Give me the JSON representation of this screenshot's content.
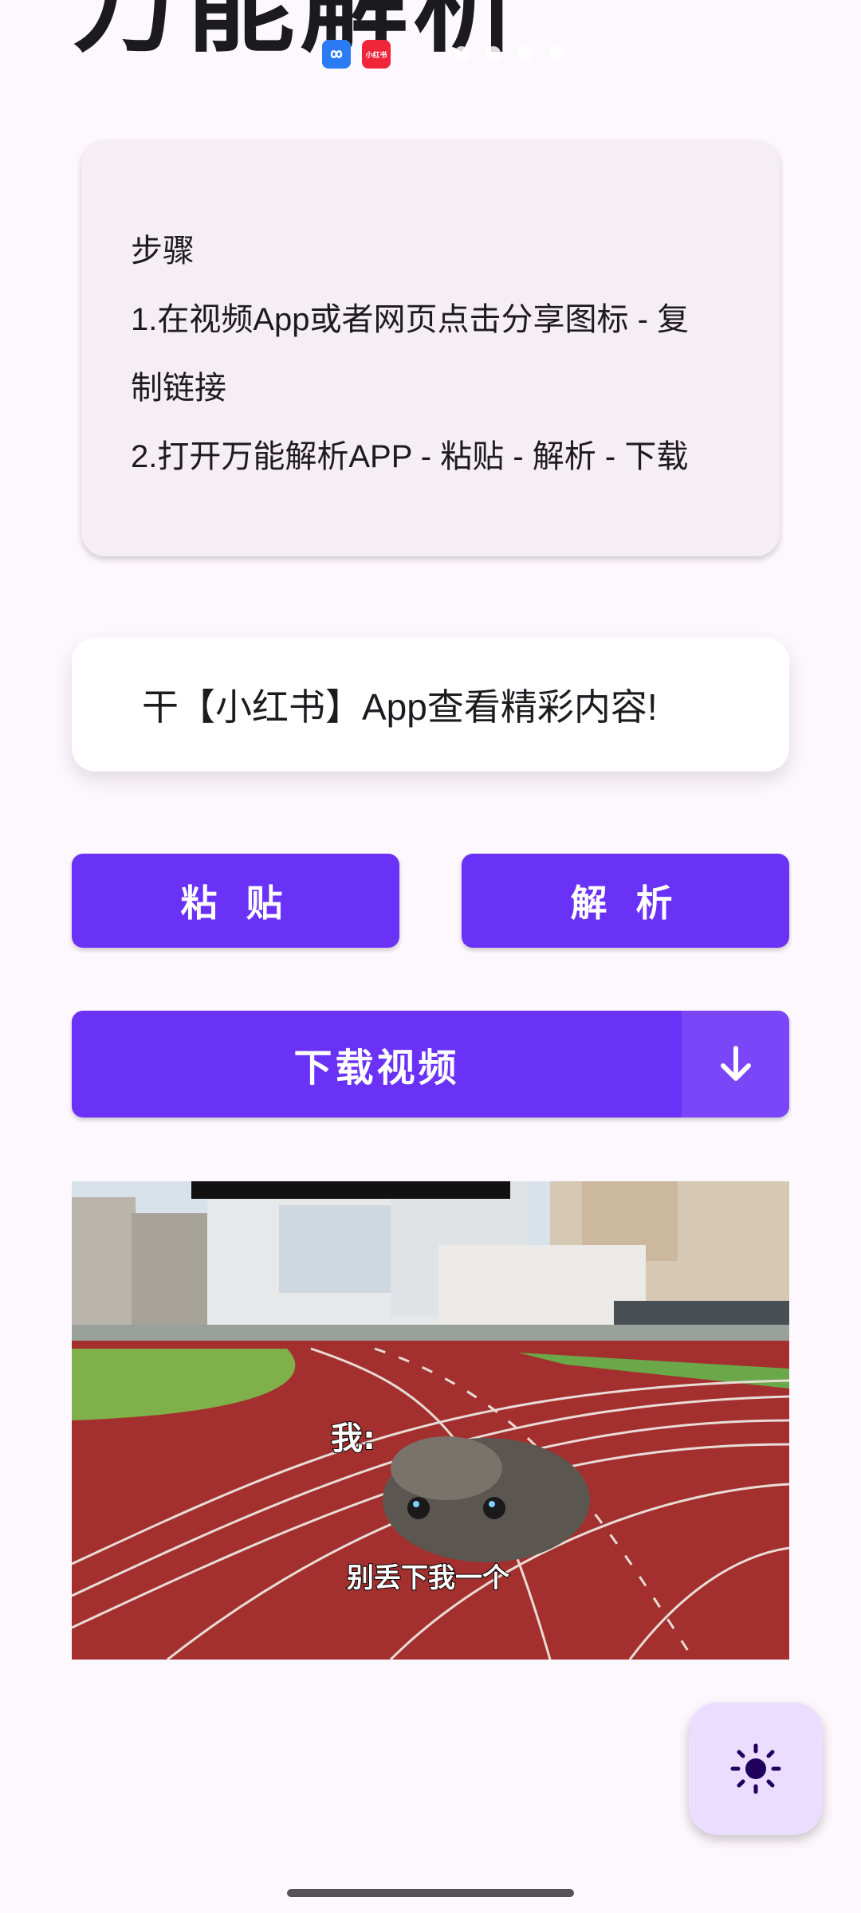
{
  "app": {
    "title": "万能解析",
    "notification_icons": [
      "cloud-sync-icon",
      "xiaohongshu-icon"
    ],
    "xhs_chip_text": "小红书"
  },
  "steps": {
    "heading": "步骤",
    "line1a": "1.在视频App或者网页点击分享图标 - 复",
    "line1b": "制链接",
    "line2": "2.打开万能解析APP - 粘贴 - 解析 - 下载"
  },
  "link_input": {
    "value": "干【小红书】App查看精彩内容!"
  },
  "buttons": {
    "paste": "粘 贴",
    "parse": "解 析",
    "download": "下载视频"
  },
  "video": {
    "overlay_me": "我:",
    "caption": "别丢下我一个"
  },
  "fab": {
    "icon": "brightness-icon"
  },
  "colors": {
    "primary": "#6a31f7",
    "fab_bg": "#eaddff",
    "background": "#fdf8fd"
  }
}
